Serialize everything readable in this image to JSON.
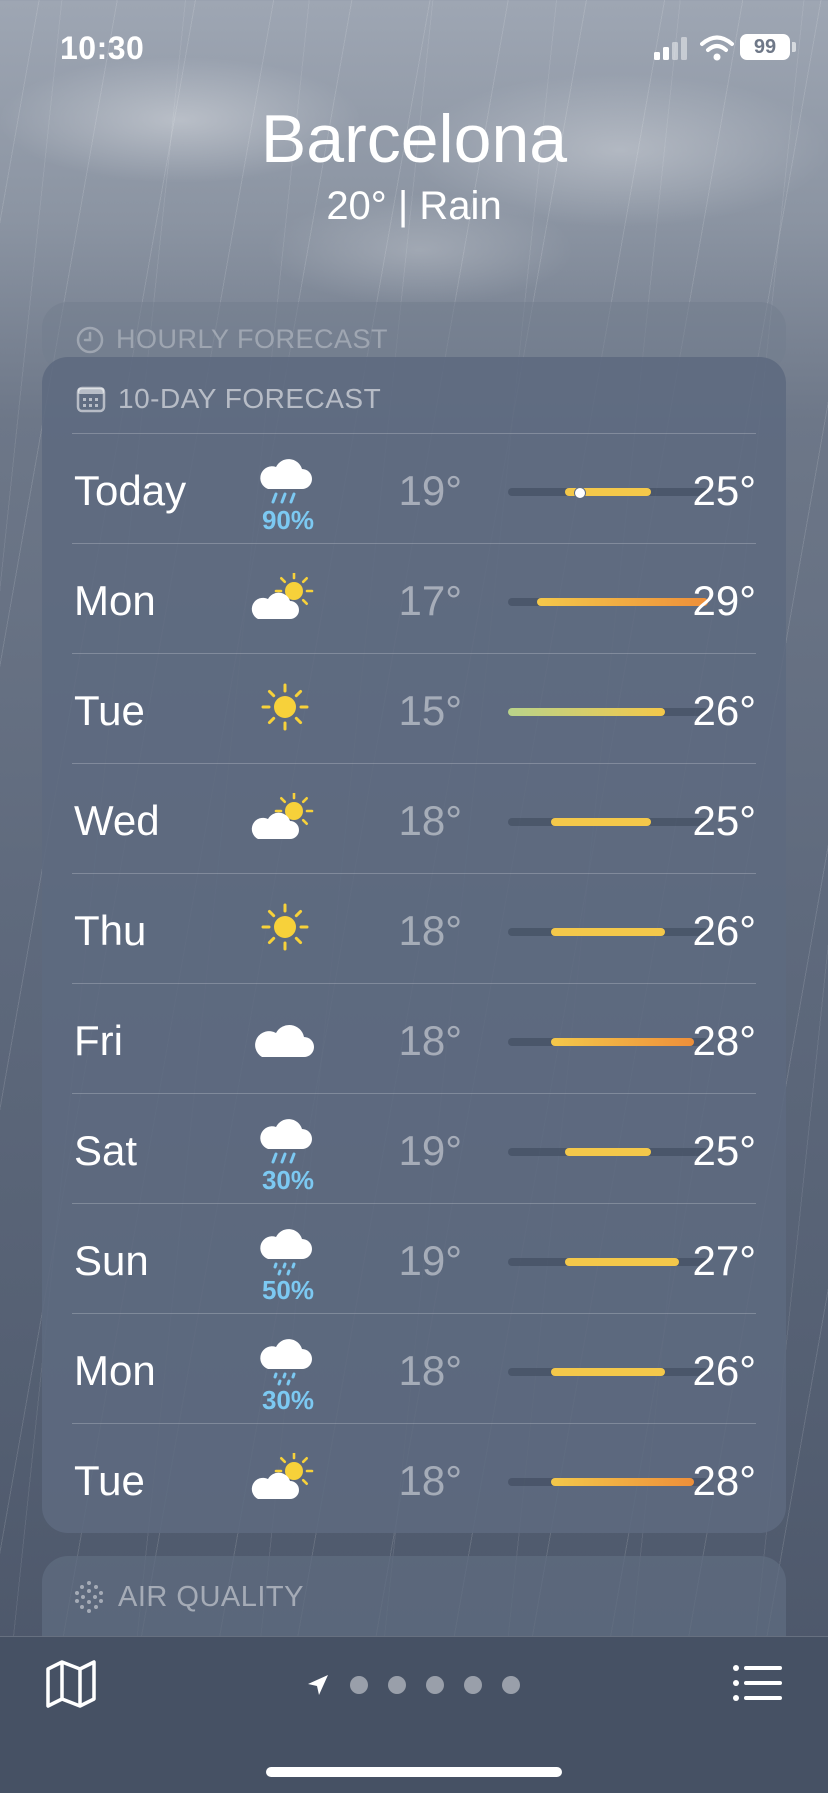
{
  "status_bar": {
    "time": "10:30",
    "battery": "99"
  },
  "location": {
    "city": "Barcelona",
    "summary": "20°  |  Rain"
  },
  "hourly": {
    "header": "HOURLY FORECAST",
    "icon": "clock-icon"
  },
  "forecast": {
    "header": "10-DAY FORECAST",
    "icon": "calendar-icon",
    "range_min": 15,
    "range_max": 29,
    "current_temp": 20,
    "days": [
      {
        "day": "Today",
        "icon": "cloud-rain-heavy-icon",
        "precip": "90%",
        "low": "19°",
        "high": "25°",
        "low_val": 19,
        "high_val": 25
      },
      {
        "day": "Mon",
        "icon": "partly-sunny-icon",
        "precip": "",
        "low": "17°",
        "high": "29°",
        "low_val": 17,
        "high_val": 29
      },
      {
        "day": "Tue",
        "icon": "sun-icon",
        "precip": "",
        "low": "15°",
        "high": "26°",
        "low_val": 15,
        "high_val": 26
      },
      {
        "day": "Wed",
        "icon": "partly-sunny-icon",
        "precip": "",
        "low": "18°",
        "high": "25°",
        "low_val": 18,
        "high_val": 25
      },
      {
        "day": "Thu",
        "icon": "sun-icon",
        "precip": "",
        "low": "18°",
        "high": "26°",
        "low_val": 18,
        "high_val": 26
      },
      {
        "day": "Fri",
        "icon": "cloud-icon",
        "precip": "",
        "low": "18°",
        "high": "28°",
        "low_val": 18,
        "high_val": 28
      },
      {
        "day": "Sat",
        "icon": "cloud-rain-heavy-icon",
        "precip": "30%",
        "low": "19°",
        "high": "25°",
        "low_val": 19,
        "high_val": 25
      },
      {
        "day": "Sun",
        "icon": "cloud-drizzle-icon",
        "precip": "50%",
        "low": "19°",
        "high": "27°",
        "low_val": 19,
        "high_val": 27
      },
      {
        "day": "Mon",
        "icon": "cloud-drizzle-icon",
        "precip": "30%",
        "low": "18°",
        "high": "26°",
        "low_val": 18,
        "high_val": 26
      },
      {
        "day": "Tue",
        "icon": "partly-sunny-icon",
        "precip": "",
        "low": "18°",
        "high": "28°",
        "low_val": 18,
        "high_val": 28
      }
    ]
  },
  "air_quality": {
    "header": "AIR QUALITY",
    "icon": "air-quality-icon"
  },
  "bottom_bar": {
    "pages": 5,
    "active_page": 0
  },
  "colors": {
    "precip": "#7cc9f2",
    "sun": "#f7d13a",
    "bar_cool": "#b9d38a",
    "bar_warm": "#f4c84a",
    "bar_hot": "#ee8f3a"
  }
}
